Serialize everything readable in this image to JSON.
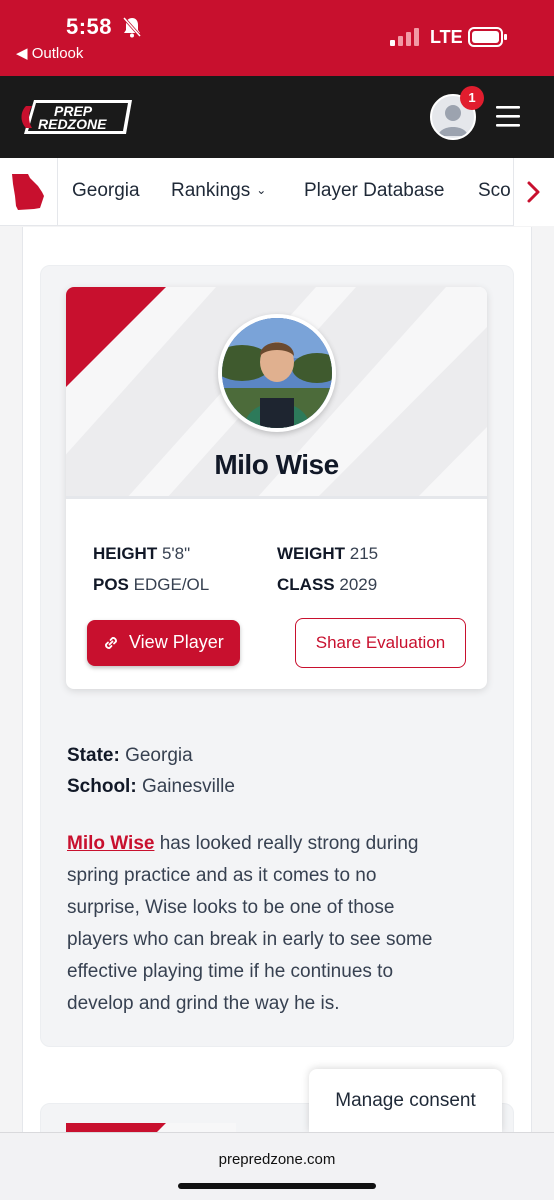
{
  "status_bar": {
    "time": "5:58",
    "back_app": "◀ Outlook",
    "network": "LTE"
  },
  "header": {
    "logo_text": "PREP REDZONE",
    "notification_count": "1"
  },
  "nav": {
    "items": [
      "Georgia",
      "Rankings",
      "Player Database",
      "Sco"
    ],
    "state_icon": "georgia-state-icon",
    "next_icon": "chevron-right-icon"
  },
  "player": {
    "name": "Milo Wise",
    "height_label": "HEIGHT",
    "height_value": "5'8\"",
    "weight_label": "WEIGHT",
    "weight_value": "215",
    "pos_label": "POS",
    "pos_value": "EDGE/OL",
    "class_label": "CLASS",
    "class_value": "2029",
    "view_button": "View Player",
    "share_button": "Share Evaluation"
  },
  "details": {
    "state_label": "State:",
    "state_value": "Georgia",
    "school_label": "School:",
    "school_value": "Gainesville"
  },
  "evaluation": {
    "link_text": "Milo Wise",
    "line1_rest": " has looked really strong during",
    "lines": [
      "spring practice and as it comes to no",
      "surprise, Wise looks to be one of those",
      "players who can break in early to see some",
      "effective playing time if he continues to",
      "develop and grind the way he is."
    ]
  },
  "consent": {
    "label": "Manage consent"
  },
  "browser": {
    "url": "prepredzone.com"
  },
  "colors": {
    "brand_red": "#c8102e",
    "header_dark": "#1a1a1a"
  }
}
